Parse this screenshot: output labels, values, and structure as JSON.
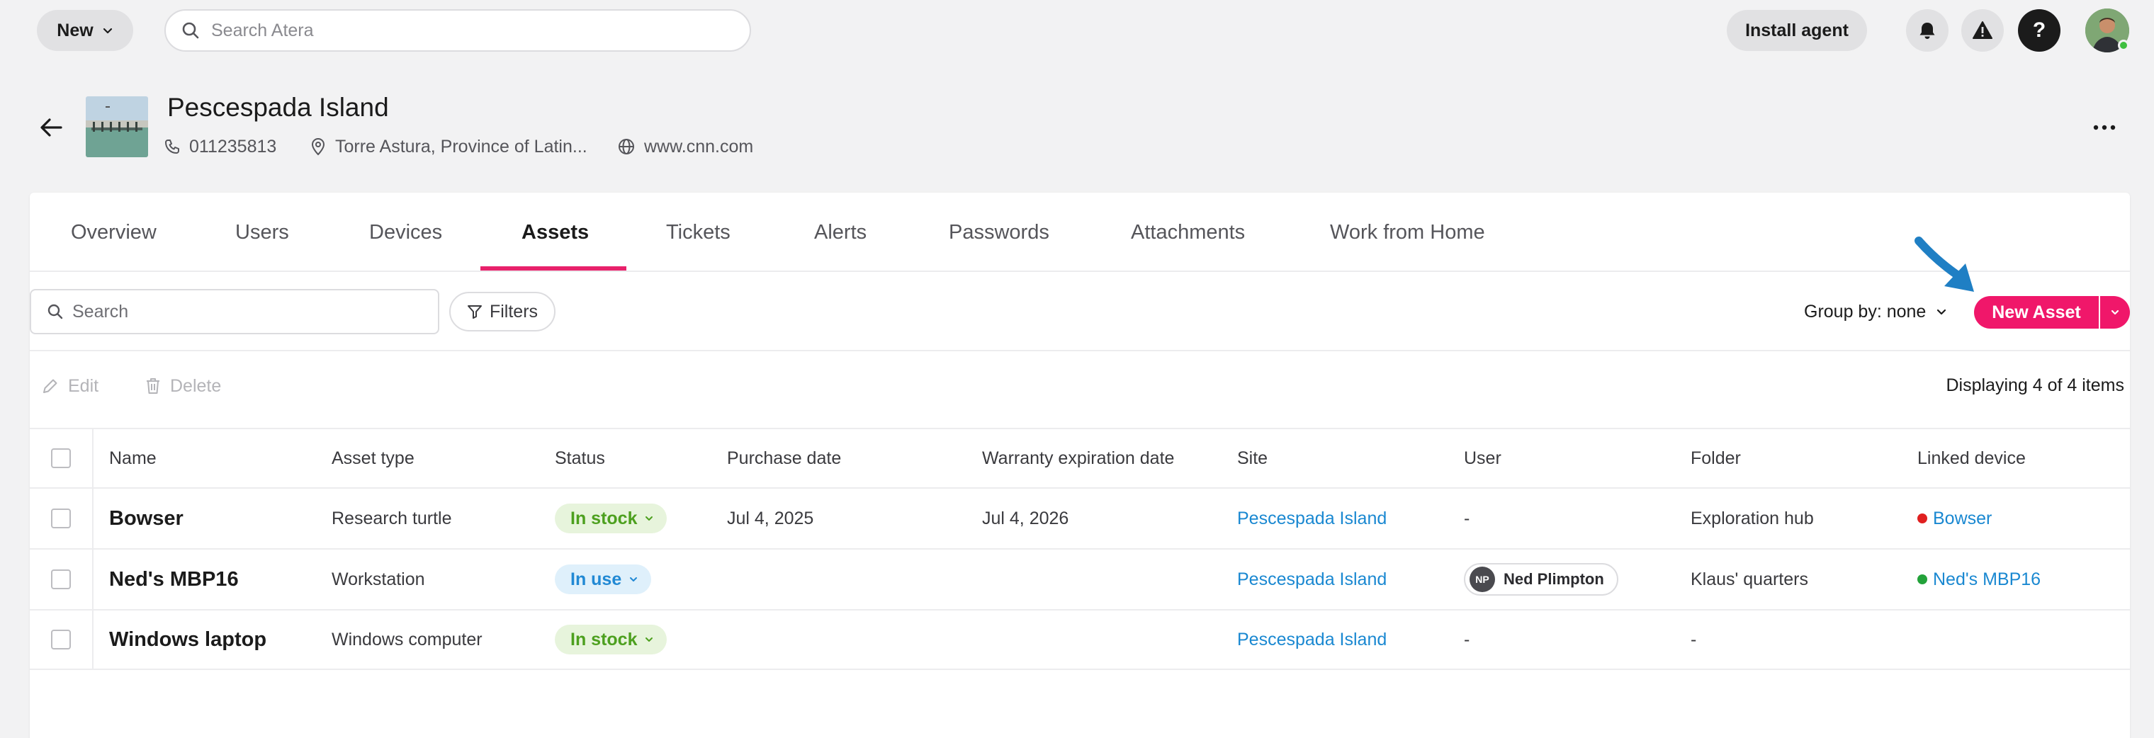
{
  "topbar": {
    "new_label": "New",
    "search_placeholder": "Search Atera",
    "install_agent_label": "Install agent",
    "help_label": "?"
  },
  "header": {
    "title": "Pescespada Island",
    "phone": "011235813",
    "address": "Torre Astura, Province of Latin...",
    "website": "www.cnn.com"
  },
  "tabs": [
    {
      "label": "Overview"
    },
    {
      "label": "Users"
    },
    {
      "label": "Devices"
    },
    {
      "label": "Assets"
    },
    {
      "label": "Tickets"
    },
    {
      "label": "Alerts"
    },
    {
      "label": "Passwords"
    },
    {
      "label": "Attachments"
    },
    {
      "label": "Work from Home"
    }
  ],
  "active_tab": "Assets",
  "controls": {
    "search_placeholder": "Search",
    "filters_label": "Filters",
    "group_by_label": "Group by: none",
    "new_asset_label": "New Asset",
    "edit_label": "Edit",
    "delete_label": "Delete",
    "displaying_text": "Displaying 4 of 4 items"
  },
  "table": {
    "columns": [
      "Name",
      "Asset type",
      "Status",
      "Purchase date",
      "Warranty expiration date",
      "Site",
      "User",
      "Folder",
      "Linked device"
    ],
    "rows": [
      {
        "name": "Bowser",
        "asset_type": "Research turtle",
        "status": "In stock",
        "purchase_date": "Jul 4, 2025",
        "warranty": "Jul 4, 2026",
        "site": "Pescespada Island",
        "user": "-",
        "user_initials": "",
        "folder": "Exploration hub",
        "linked_device": "Bowser",
        "linked_status_color": "#e02020"
      },
      {
        "name": "Ned's MBP16",
        "asset_type": "Workstation",
        "status": "In use",
        "purchase_date": "",
        "warranty": "",
        "site": "Pescespada Island",
        "user": "Ned Plimpton",
        "user_initials": "NP",
        "folder": "Klaus' quarters",
        "linked_device": "Ned's MBP16",
        "linked_status_color": "#23a23a"
      },
      {
        "name": "Windows laptop",
        "asset_type": "Windows computer",
        "status": "In stock",
        "purchase_date": "",
        "warranty": "",
        "site": "Pescespada Island",
        "user": "-",
        "user_initials": "",
        "folder": "-",
        "linked_device": "",
        "linked_status_color": ""
      }
    ]
  },
  "colors": {
    "accent": "#f0176a",
    "link": "#1a88d1",
    "in_stock_text": "#4da01f",
    "in_use_text": "#2189d4"
  }
}
